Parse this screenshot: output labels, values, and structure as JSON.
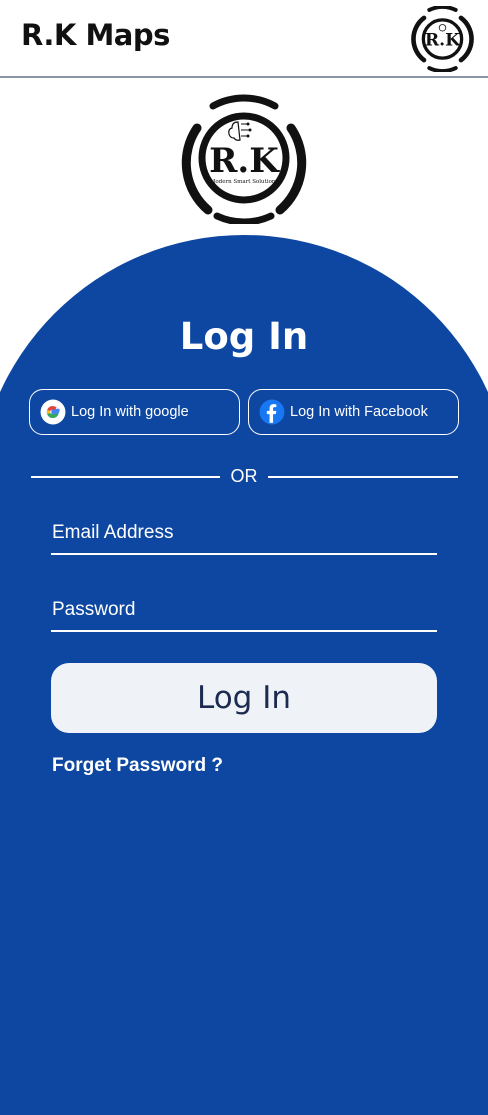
{
  "header": {
    "app_title": "R.K Maps",
    "logo_icon": "rk-logo-icon"
  },
  "brand": {
    "logo_text": "R.K",
    "logo_tagline": "Modern Smart Solutions",
    "panel_color": "#0d47a1"
  },
  "login": {
    "title": "Log In",
    "google_label": "Log In with google",
    "facebook_label": "Log In with Facebook",
    "or_label": "OR",
    "email_placeholder": "Email Address",
    "email_value": "",
    "password_placeholder": "Password",
    "password_value": "",
    "submit_label": "Log In",
    "forgot_label": "Forget Password ?"
  }
}
